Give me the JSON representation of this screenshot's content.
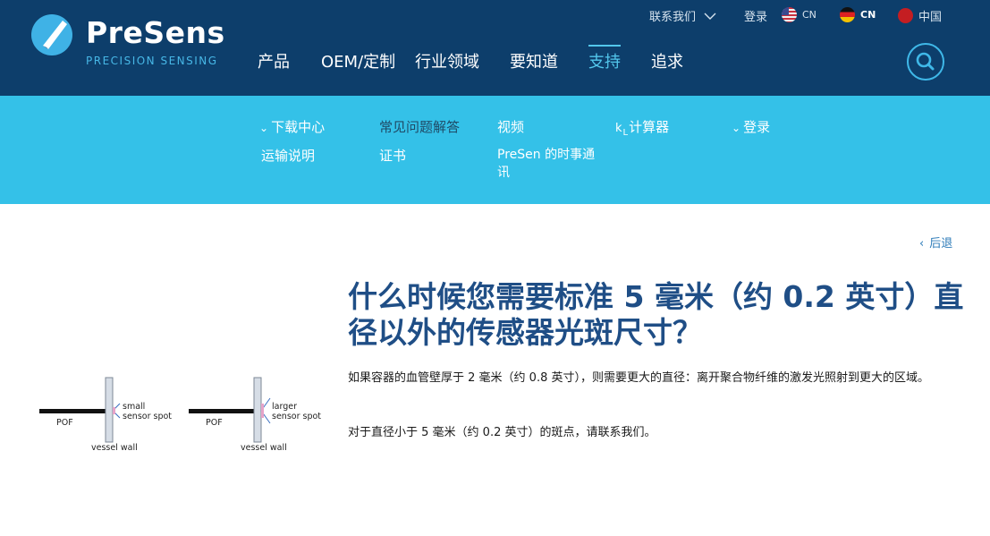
{
  "brand": {
    "name": "PreSens",
    "tagline": "PRECISION SENSING"
  },
  "topbar": {
    "contact": "联系我们",
    "login": "登录",
    "lang_us": "CN",
    "lang_de": "CN",
    "lang_cn": "中国"
  },
  "mainnav": [
    "产品",
    "OEM/定制",
    "行业领域",
    "要知道",
    "支持",
    "追求"
  ],
  "subnav": {
    "downloads": "下载中心",
    "faq": "常见问题解答",
    "videos": "视频",
    "kl_calc_k": "k",
    "kl_calc_l": "L",
    "kl_calc_rest": "计算器",
    "login": "登录",
    "shipping": "运输说明",
    "certificates": "证书",
    "newsletter": "PreSen 的时事通讯"
  },
  "back": "后退",
  "article": {
    "title": "什么时候您需要标准 5 毫米（约 0.2 英寸）直径以外的传感器光斑尺寸？",
    "p1": "如果容器的血管壁厚于 2 毫米（约 0.8 英寸），则需要更大的直径：离开聚合物纤维的激发光照射到更大的区域。",
    "p2": "对于直径小于 5 毫米（约 0.2 英寸）的斑点，请联系我们。"
  },
  "figure": {
    "left": {
      "pof": "POF",
      "spot_1": "small",
      "spot_2": "sensor spot",
      "wall": "vessel wall"
    },
    "right": {
      "pof": "POF",
      "spot_1": "larger",
      "spot_2": "sensor spot",
      "wall": "vessel wall"
    }
  },
  "colors": {
    "header": "#0d3e6b",
    "subnav": "#34c1e8",
    "accent": "#53c7ec",
    "title": "#1f4e86"
  }
}
